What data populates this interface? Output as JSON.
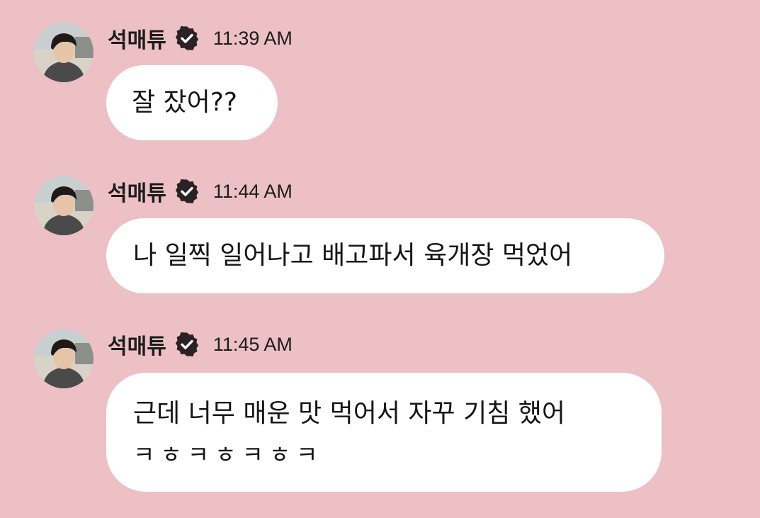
{
  "messages": [
    {
      "sender": "석매튜",
      "time": "11:39 AM",
      "text": "잘 잤어??"
    },
    {
      "sender": "석매튜",
      "time": "11:44 AM",
      "text": "나 일찍 일어나고 배고파서 육개장 먹었어"
    },
    {
      "sender": "석매튜",
      "time": "11:45 AM",
      "text_line1": "근데 너무 매운 맛 먹어서 자꾸 기침 했어",
      "text_line2": "ㅋㅎㅋㅎㅋㅎㅋ"
    }
  ],
  "icons": {
    "avatar": "profile-photo",
    "verified": "verified-badge-icon"
  },
  "colors": {
    "background": "#ecc0c4",
    "bubble": "#ffffff",
    "text": "#1c1c1c"
  }
}
